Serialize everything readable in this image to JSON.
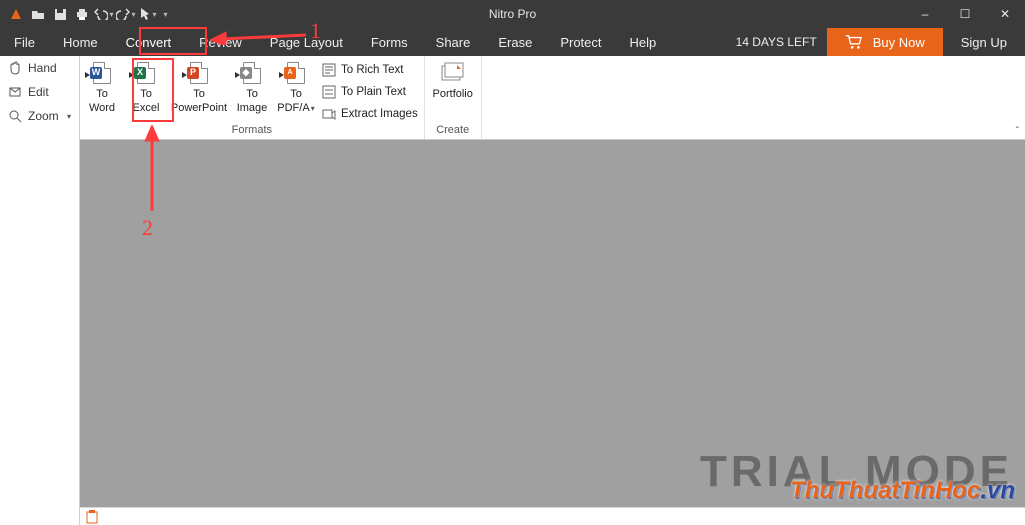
{
  "app": {
    "title": "Nitro Pro"
  },
  "qat": {
    "icons": [
      "nitro-logo-icon",
      "open-icon",
      "save-icon",
      "print-icon",
      "undo-icon",
      "redo-icon",
      "cursor-tool-icon"
    ]
  },
  "win": {
    "min": "–",
    "max": "☐",
    "close": "✕"
  },
  "tabs": {
    "items": [
      {
        "label": "File"
      },
      {
        "label": "Home"
      },
      {
        "label": "Convert",
        "active": true
      },
      {
        "label": "Review"
      },
      {
        "label": "Page Layout"
      },
      {
        "label": "Forms"
      },
      {
        "label": "Share"
      },
      {
        "label": "Erase"
      },
      {
        "label": "Protect"
      },
      {
        "label": "Help"
      }
    ]
  },
  "trial": {
    "days_left": "14 DAYS LEFT",
    "buy": "Buy Now",
    "signup": "Sign Up"
  },
  "leftpane": {
    "hand": "Hand",
    "edit": "Edit",
    "zoom": "Zoom"
  },
  "ribbon": {
    "formats": {
      "label": "Formats",
      "to_word": {
        "l1": "To",
        "l2": "Word"
      },
      "to_excel": {
        "l1": "To",
        "l2": "Excel"
      },
      "to_ppt": {
        "l1": "To",
        "l2": "PowerPoint"
      },
      "to_image": {
        "l1": "To",
        "l2": "Image"
      },
      "to_pdfa": {
        "l1": "To",
        "l2": "PDF/A"
      },
      "to_rich": "To Rich Text",
      "to_plain": "To Plain Text",
      "extract_images": "Extract Images"
    },
    "create": {
      "label": "Create",
      "portfolio": "Portfolio"
    }
  },
  "watermark": {
    "trial": "TRIAL MODE",
    "site_a": "ThuThuatTinHoc",
    "site_b": ".vn"
  },
  "annot": {
    "n1": "1",
    "n2": "2"
  }
}
